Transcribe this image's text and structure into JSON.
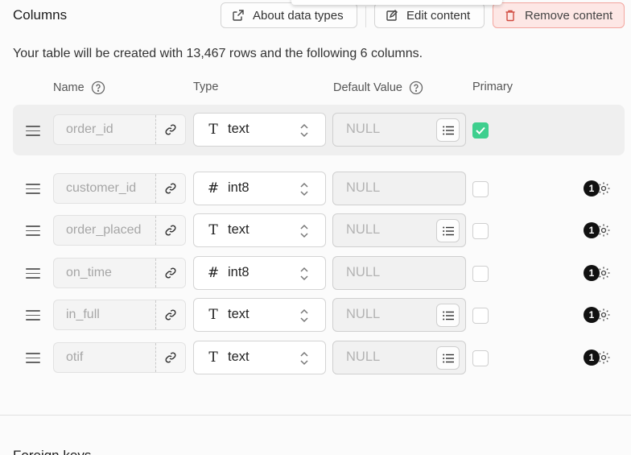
{
  "header": {
    "title": "Columns",
    "about_label": "About data types",
    "edit_label": "Edit content",
    "remove_label": "Remove content"
  },
  "description": "Your table will be created with 13,467 rows and the following 6 columns.",
  "table_headers": {
    "name": "Name",
    "type": "Type",
    "default": "Default Value",
    "primary": "Primary"
  },
  "rows": [
    {
      "name": "order_id",
      "type": "text",
      "type_icon": "text-type-icon",
      "default": "NULL",
      "has_list_button": true,
      "primary": true,
      "badge": ""
    },
    {
      "name": "customer_id",
      "type": "int8",
      "type_icon": "hash-type-icon",
      "default": "NULL",
      "has_list_button": false,
      "primary": false,
      "badge": "1"
    },
    {
      "name": "order_placed",
      "type": "text",
      "type_icon": "text-type-icon",
      "default": "NULL",
      "has_list_button": true,
      "primary": false,
      "badge": "1"
    },
    {
      "name": "on_time",
      "type": "int8",
      "type_icon": "hash-type-icon",
      "default": "NULL",
      "has_list_button": false,
      "primary": false,
      "badge": "1"
    },
    {
      "name": "in_full",
      "type": "text",
      "type_icon": "text-type-icon",
      "default": "NULL",
      "has_list_button": true,
      "primary": false,
      "badge": "1"
    },
    {
      "name": "otif",
      "type": "text",
      "type_icon": "text-type-icon",
      "default": "NULL",
      "has_list_button": true,
      "primary": false,
      "badge": "1"
    }
  ],
  "footer_title": "Foreign keys",
  "colors": {
    "accent_green": "#3ecf8e",
    "danger_bg": "#fde7e5",
    "danger_border": "#f3a59e"
  }
}
